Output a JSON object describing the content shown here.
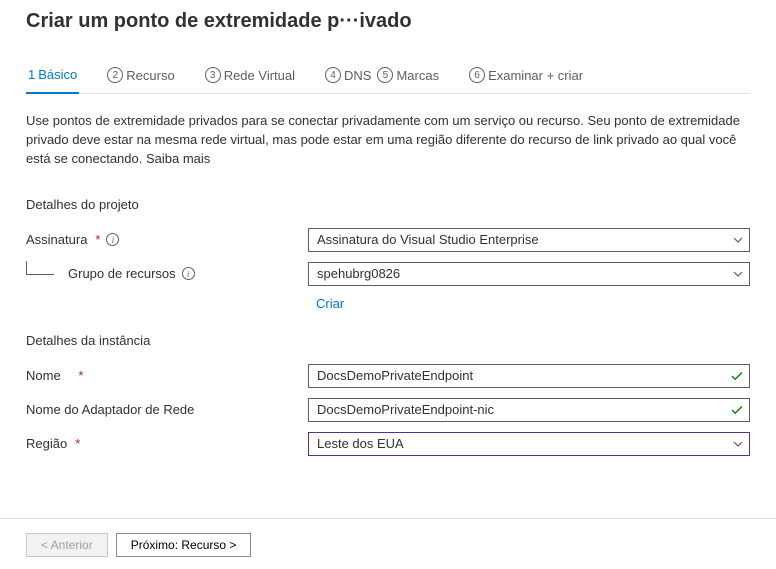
{
  "title": "Criar um ponto de extremidade p···ivado",
  "tabs": [
    {
      "num": "1",
      "label": "Básico",
      "active": true
    },
    {
      "num": "2",
      "label": "Recurso"
    },
    {
      "num": "3",
      "label": "Rede Virtual"
    },
    {
      "num": "4",
      "label": "DNS"
    },
    {
      "num": "5",
      "label": "Marcas"
    },
    {
      "num": "6",
      "label": "Examinar + criar"
    }
  ],
  "description": "Use pontos de extremidade privados para se conectar privadamente com um serviço ou recurso. Seu ponto de extremidade privado deve estar na mesma rede virtual, mas pode estar em uma região diferente do recurso de link privado ao qual você está se conectando. ",
  "learn_more": "Saiba mais",
  "sections": {
    "project": "Detalhes do projeto",
    "instance": "Detalhes da instância"
  },
  "labels": {
    "subscription": "Assinatura",
    "resource_group": "Grupo de recursos",
    "create_new": "Criar",
    "name": "Nome",
    "nic_name": "Nome do Adaptador de Rede",
    "region": "Região"
  },
  "values": {
    "subscription": "Assinatura do Visual Studio Enterprise",
    "resource_group": "spehubrg0826",
    "name": "DocsDemoPrivateEndpoint",
    "nic_name": "DocsDemoPrivateEndpoint-nic",
    "region": "Leste dos EUA"
  },
  "footer": {
    "prev": "<  Anterior",
    "next": "Próximo: Recurso  >"
  }
}
